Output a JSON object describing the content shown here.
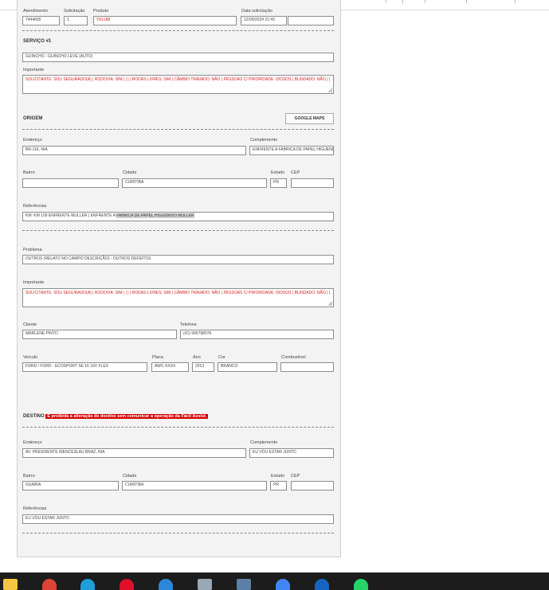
{
  "top_labels": {
    "col1": "Atendimento",
    "col2": "Solicitação",
    "col3": "Produto",
    "col4": "Data solicitação"
  },
  "top_values": {
    "atendimento": "7444665",
    "solicitacao": "1",
    "produto": "YELUM",
    "data": "12/09/2024 21:43",
    "extra": ""
  },
  "servico": {
    "title": "SERVIÇO #1",
    "service_value": "GUINCHO - GUINCHO LEVE (AUTO)",
    "importante_label": "Importante",
    "importante_text": "SOLICITANTE: SOU SEGURADO(A) | RODOVIA: SIM | | | | RODAS LIVRES: SIM | CÂMBIO TRAVADO: NÃO | PESSOAS C/ PRIORIDADE: IDOSOS | BLINDADO: NÃO | |"
  },
  "origem": {
    "title": "ORIGEM",
    "maps_button": "GOOGLE MAPS",
    "endereco_label": "Endereço",
    "endereco": "BR-116, N/A",
    "complemento_label": "Complemento",
    "complemento": "ENFRENTE A FABRICA DE PAPEL HIGUENIVO MULLER",
    "bairro_label": "Bairro",
    "bairro": "",
    "cidade_label": "Cidade",
    "cidade": "CURITIBA",
    "estado_label": "Estado",
    "estado": "PR",
    "cep_label": "CEP",
    "cep": "",
    "referencias_label": "Referências",
    "referencias_pre": "KM: KM 109 ENFRENTE  MULLER | ENFRENTE A ",
    "referencias_hl": "FABRICA DE PAPEL  HIGUENIVO MULLER"
  },
  "problema": {
    "label": "Problema",
    "value": "OUTROS (RELATO NO CAMPO DESCRIÇÃO) - OUTROS DEFEITOS",
    "importante_label": "Importante",
    "importante_text": "SOLICITANTE: SOU SEGURADO(A) | RODOVIA: SIM | | | | RODAS LIVRES: SIM | CÂMBIO TRAVADO: NÃO | PESSOAS C/ PRIORIDADE: IDOSOS | BLINDADO: NÃO | |"
  },
  "cliente": {
    "cliente_label": "Cliente",
    "cliente": "MARLENE PINTO",
    "telefone_label": "Telefone",
    "telefone": "(41) 995798076"
  },
  "veiculo": {
    "veiculo_label": "Veículo",
    "veiculo": "FORD / FORD - ECOSPORT SE 16 16V FLEX",
    "placa_label": "Placa",
    "placa": "AWC-XXXX",
    "ano_label": "Ano",
    "ano": "2013",
    "cor_label": "Cor",
    "cor": "BRANCO",
    "combustivel_label": "Combustível",
    "combustivel": ""
  },
  "destino": {
    "title": "DESTINO",
    "warning": "É proibida a alteração de destino sem comunicar a operação da Fácil Assist.",
    "endereco_label": "Endereço",
    "endereco": "AV. PRESIDENTE WENCESLAU BRAZ, N/A",
    "complemento_label": "Complemento",
    "complemento": "EU VOU ESTAR JUNTO",
    "bairro_label": "Bairro",
    "bairro": "GUAÍRA",
    "cidade_label": "Cidade",
    "cidade": "CURITIBA",
    "estado_label": "Estado",
    "estado": "PR",
    "cep_label": "CEP",
    "cep": "",
    "referencias_label": "Referências",
    "referencias": "EU VOU ESTAR JUNTO"
  },
  "taskbar": {
    "icons": [
      "file-explorer-icon",
      "chrome-icon",
      "edge-icon",
      "opera-icon",
      "phone-icon",
      "notepad-icon",
      "calculator-icon",
      "google-icon",
      "app-icon",
      "whatsapp-icon"
    ],
    "colors": {
      "explorer": "#f4c542",
      "chrome": "#db4437",
      "edge": "#1f9ed8",
      "opera": "#e0102a",
      "phone": "#2b88d8",
      "notepad": "#9aa7b4",
      "calculator": "#5b7fa6",
      "google": "#4285f4",
      "app": "#1565c0",
      "whatsapp": "#25d366"
    }
  }
}
